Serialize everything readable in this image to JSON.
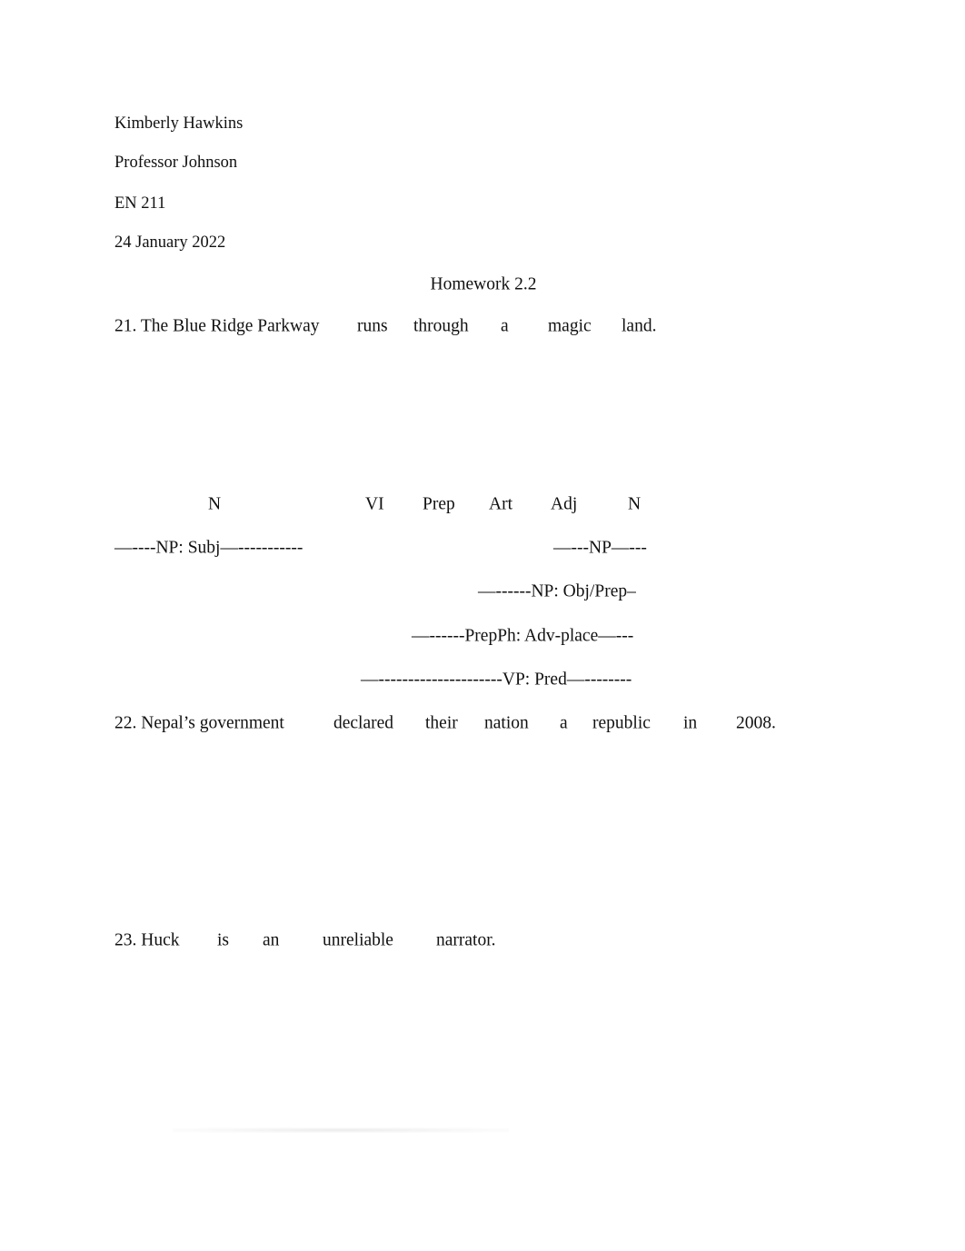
{
  "header": {
    "student_name": "Kimberly Hawkins",
    "professor": "Professor Johnson",
    "course": "EN 211",
    "date": "24 January 2022"
  },
  "title": "Homework 2.2",
  "exercises": [
    {
      "number": "21.",
      "words": [
        "21. The Blue Ridge Parkway",
        "runs",
        "through",
        "a",
        "magic",
        "land."
      ],
      "pos_tags": [
        "N",
        "VI",
        "Prep",
        "Art",
        "Adj",
        "N"
      ],
      "phrase_labels": [
        "—----NP: Subj—-----------",
        "—---NP—---",
        "—------NP: Obj/Prep–",
        "—------PrepPh: Adv-place—---",
        "—---------------------VP: Pred—--------"
      ]
    },
    {
      "number": "22.",
      "words": [
        "22. Nepal’s government",
        "declared",
        "their",
        "nation",
        "a",
        "republic",
        "in",
        "2008."
      ]
    },
    {
      "number": "23.",
      "words": [
        "23. Huck",
        "is",
        "an",
        "unreliable",
        "narrator."
      ]
    }
  ]
}
